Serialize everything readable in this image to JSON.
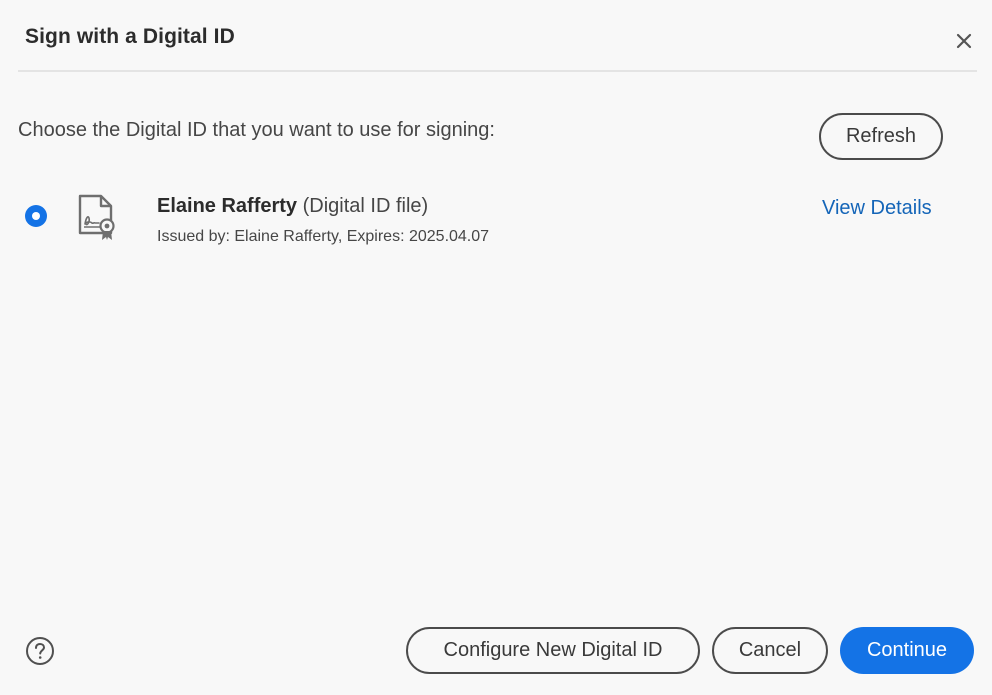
{
  "dialog": {
    "title": "Sign with a Digital ID",
    "close_icon": "close-icon",
    "instruction": "Choose the Digital ID that you want to use for signing:",
    "refresh_label": "Refresh"
  },
  "digital_ids": [
    {
      "selected": true,
      "icon": "certificate-icon",
      "name": "Elaine Rafferty",
      "type": "(Digital ID file)",
      "issued": "Issued by: Elaine Rafferty, Expires: 2025.04.07",
      "view_details_label": "View Details"
    }
  ],
  "footer": {
    "help_icon": "help-icon",
    "configure_label": "Configure New Digital ID",
    "cancel_label": "Cancel",
    "continue_label": "Continue"
  },
  "colors": {
    "accent": "#1473e6",
    "link": "#1465b8",
    "background": "#f8f8f8"
  }
}
